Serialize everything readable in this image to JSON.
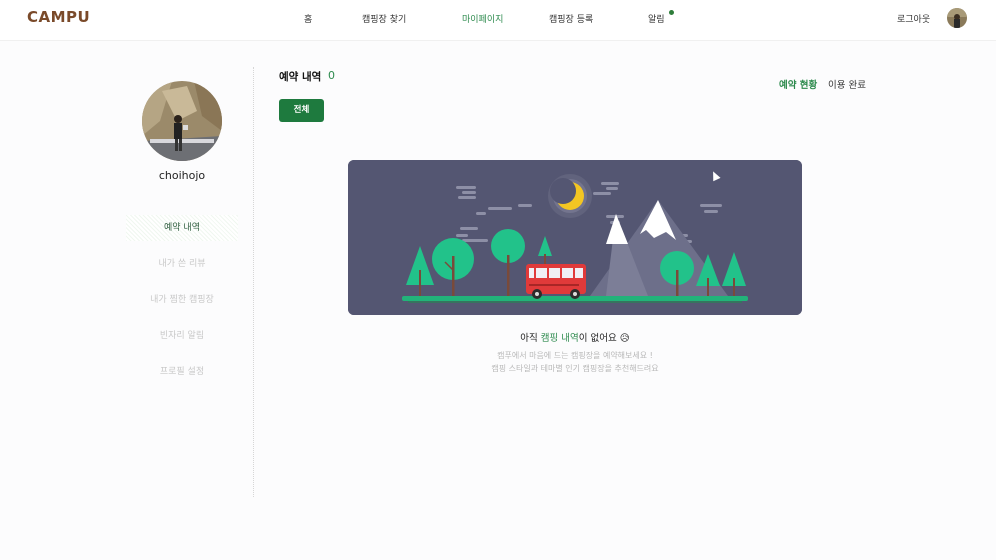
{
  "header": {
    "logo": "CAMPU",
    "nav": [
      {
        "label": "홈"
      },
      {
        "label": "캠핑장 찾기"
      },
      {
        "label": "마이페이지",
        "active": true
      },
      {
        "label": "캠핑장 등록"
      },
      {
        "label": "알림",
        "has_dot": true
      }
    ],
    "logout": "로그아웃"
  },
  "profile": {
    "username": "choihojo"
  },
  "sidebar": {
    "items": [
      {
        "label": "예약 내역",
        "active": true
      },
      {
        "label": "내가 쓴 리뷰"
      },
      {
        "label": "내가 찜한 캠핑장"
      },
      {
        "label": "빈자리 알림"
      },
      {
        "label": "프로필 설정"
      }
    ]
  },
  "main": {
    "title": "예약 내역",
    "count": "0",
    "tabs": [
      {
        "label": "예약 현황",
        "active": true
      },
      {
        "label": "이용 완료"
      }
    ],
    "filter_button": "전체",
    "empty": {
      "title_prefix": "아직 ",
      "title_highlight": "캠핑 내역",
      "title_suffix": "이 없어요 😥",
      "line1": "캠푸에서 마음에 드는 캠핑장을 예약해보세요 !",
      "line2": "캠핑 스타일과 테마별 인기 캠핑장을 추천해드려요"
    }
  },
  "colors": {
    "accent": "#2e8b4e",
    "button": "#1e7a3e",
    "illustration_bg": "#545672",
    "logo": "#7a4a2a"
  }
}
